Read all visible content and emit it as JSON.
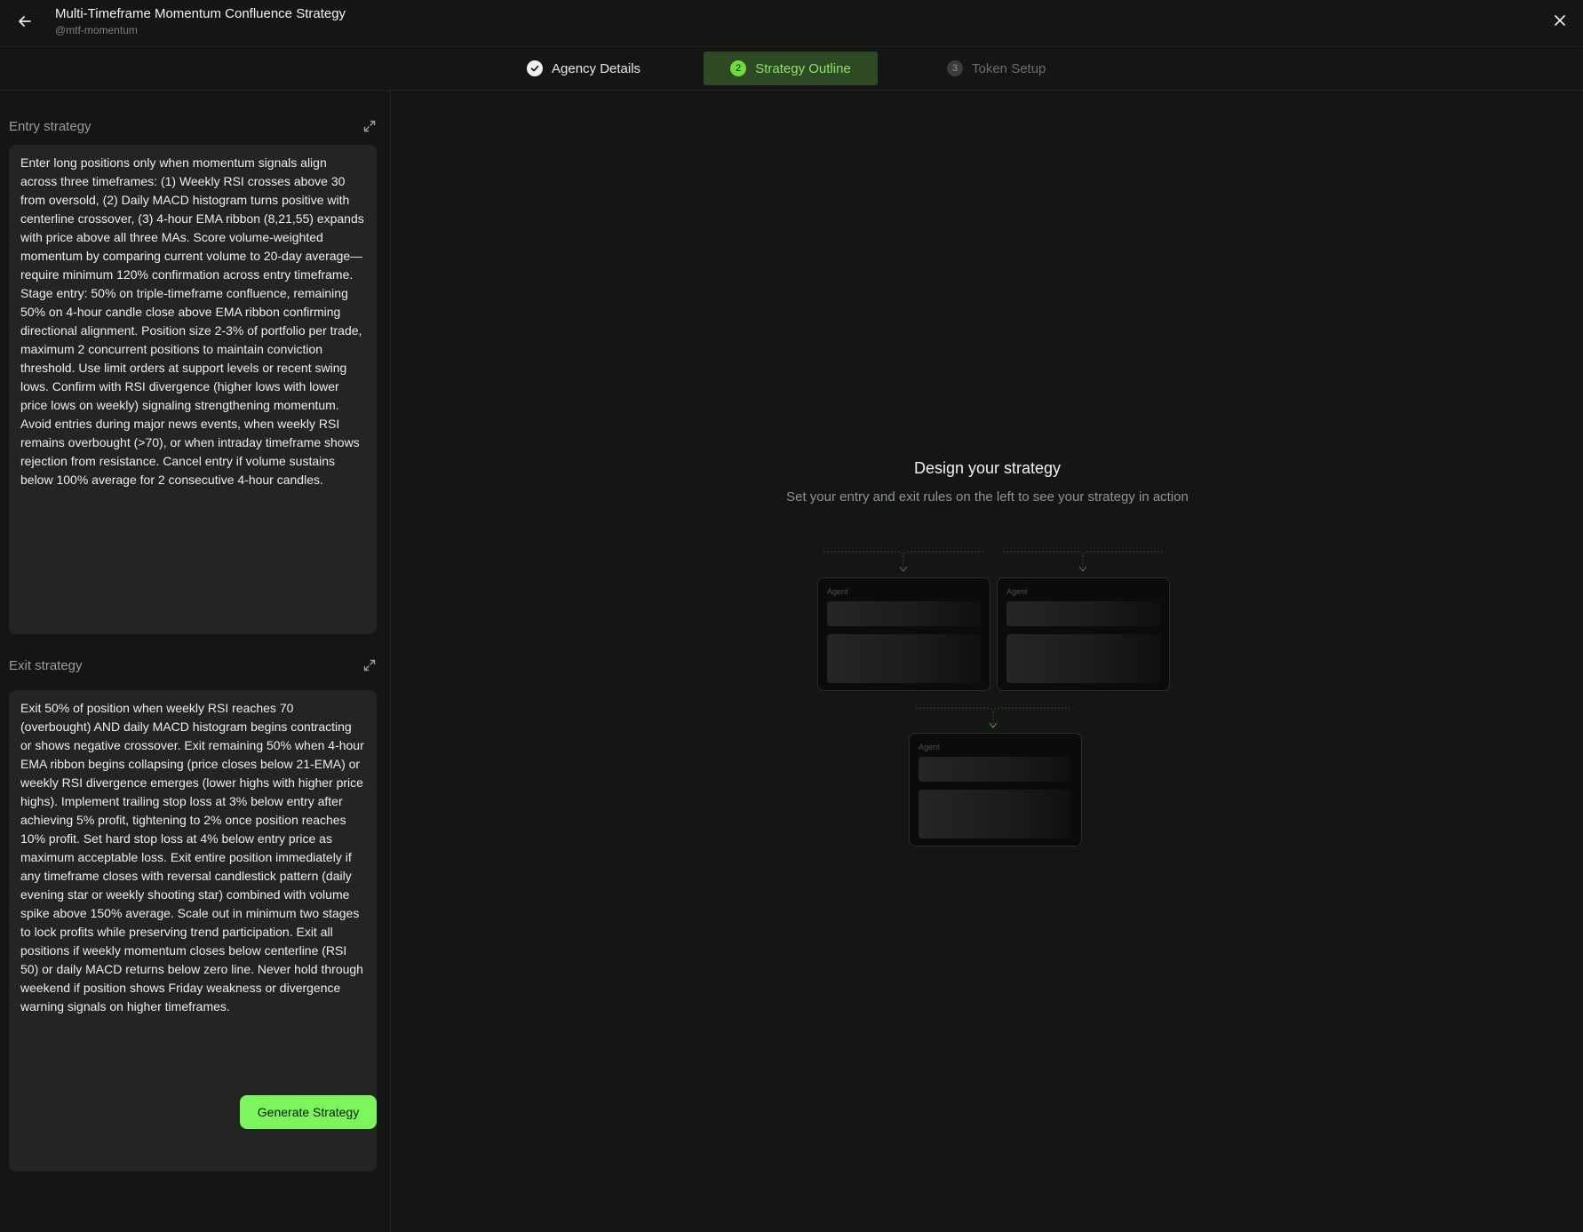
{
  "header": {
    "title": "Multi-Timeframe Momentum Confluence Strategy",
    "handle": "@mtf-momentum",
    "back_icon": "arrow-left-icon",
    "close_icon": "close-icon"
  },
  "steps": [
    {
      "number": "",
      "label": "Agency Details",
      "state": "completed"
    },
    {
      "number": "2",
      "label": "Strategy Outline",
      "state": "active"
    },
    {
      "number": "3",
      "label": "Token Setup",
      "state": "upcoming"
    }
  ],
  "entry": {
    "label": "Entry strategy",
    "text": "Enter long positions only when momentum signals align across three timeframes: (1) Weekly RSI crosses above 30 from oversold, (2) Daily MACD histogram turns positive with centerline crossover, (3) 4-hour EMA ribbon (8,21,55) expands with price above all three MAs. Score volume-weighted momentum by comparing current volume to 20-day average—require minimum 120% confirmation across entry timeframe. Stage entry: 50% on triple-timeframe confluence, remaining 50% on 4-hour candle close above EMA ribbon confirming directional alignment. Position size 2-3% of portfolio per trade, maximum 2 concurrent positions to maintain conviction threshold. Use limit orders at support levels or recent swing lows. Confirm with RSI divergence (higher lows with lower price lows on weekly) signaling strengthening momentum. Avoid entries during major news events, when weekly RSI remains overbought (>70), or when intraday timeframe shows rejection from resistance. Cancel entry if volume sustains below 100% average for 2 consecutive 4-hour candles."
  },
  "exit": {
    "label": "Exit strategy",
    "text": "Exit 50% of position when weekly RSI reaches 70 (overbought) AND daily MACD histogram begins contracting or shows negative crossover. Exit remaining 50% when 4-hour EMA ribbon begins collapsing (price closes below 21-EMA) or weekly RSI divergence emerges (lower highs with higher price highs). Implement trailing stop loss at 3% below entry after achieving 5% profit, tightening to 2% once position reaches 10% profit. Set hard stop loss at 4% below entry price as maximum acceptable loss. Exit entire position immediately if any timeframe closes with reversal candlestick pattern (daily evening star or weekly shooting star) combined with volume spike above 150% average. Scale out in minimum two stages to lock profits while preserving trend participation. Exit all positions if weekly momentum closes below centerline (RSI 50) or daily MACD returns below zero line. Never hold through weekend if position shows Friday weakness or divergence warning signals on higher timeframes."
  },
  "generate_label": "Generate Strategy",
  "preview": {
    "title": "Design your strategy",
    "subtitle": "Set your entry and exit rules on the left to see your strategy in action",
    "agent_label": "Agent"
  },
  "colors": {
    "accent": "#7bf55b",
    "active_step_bg": "#2d4a25",
    "active_step_text": "#8fe26a"
  }
}
